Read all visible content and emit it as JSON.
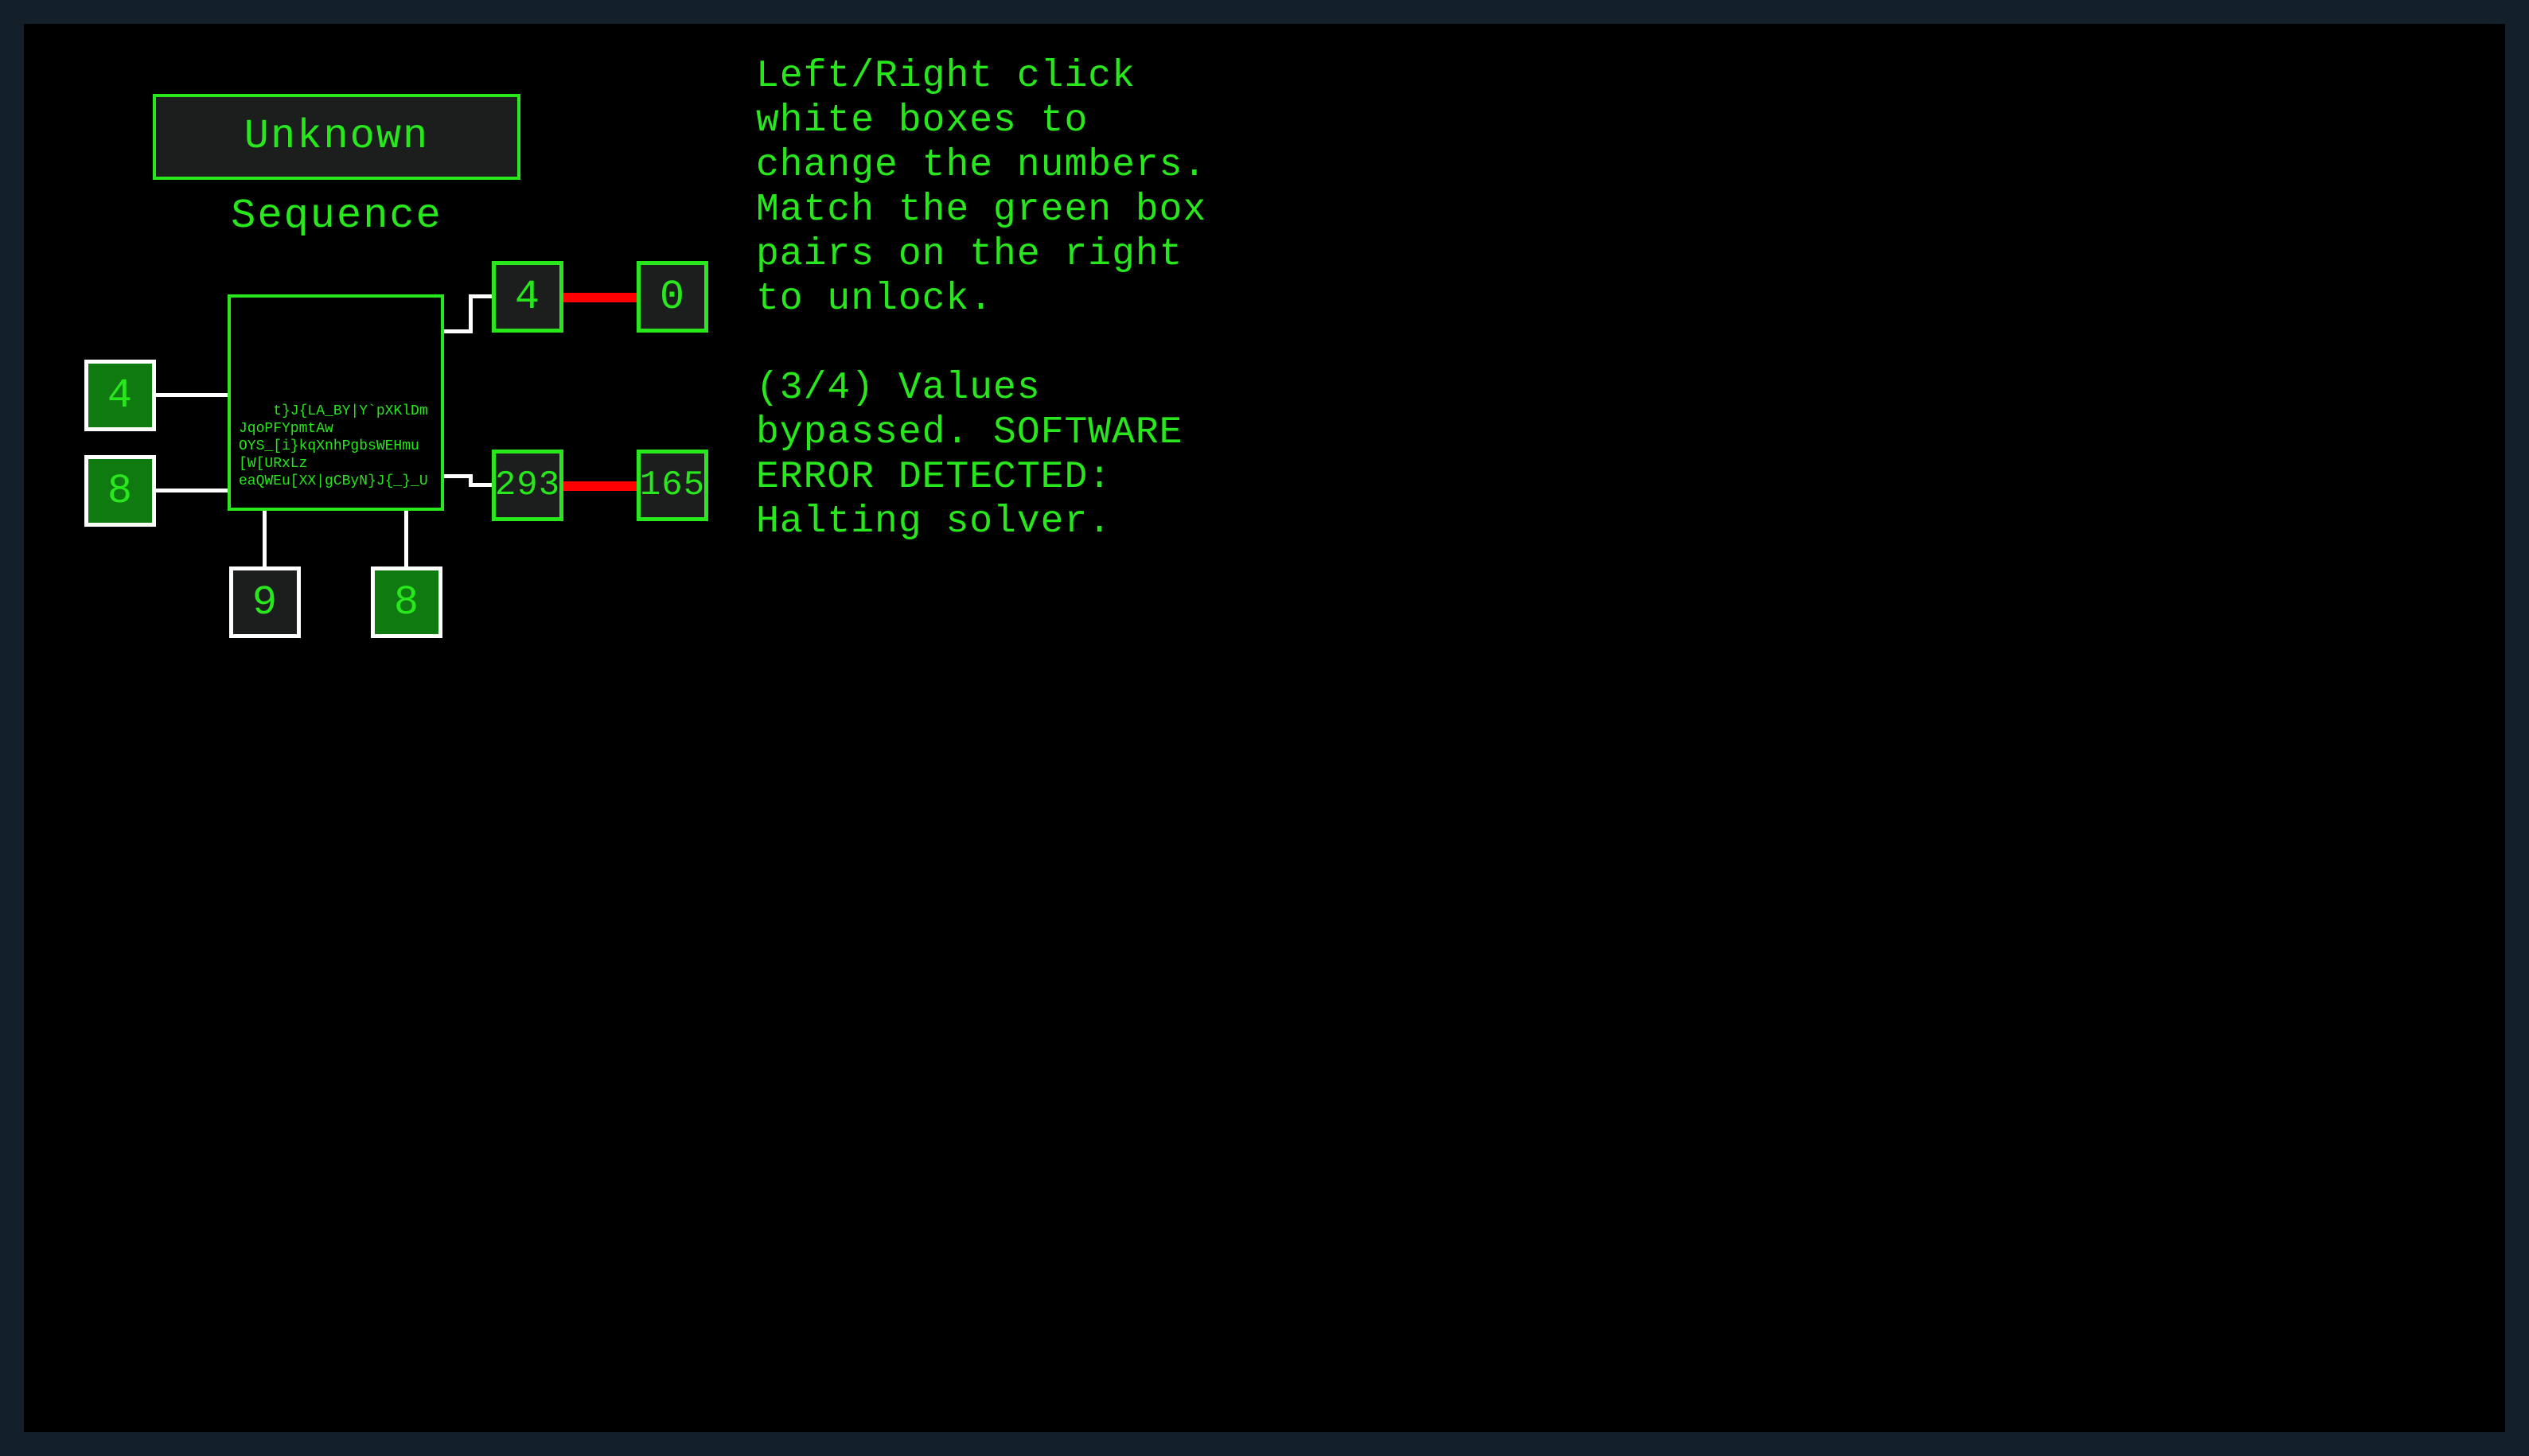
{
  "title": "Unknown Sequence",
  "central_text": "t}J{LA_BY|Y`pXKlDmJqoPFYpmtAw\nOYS_[i}kqXnhPgbsWEHmu[W[URxLz\neaQWEu[XX|gCByN}J{_}_U",
  "inputs": {
    "left_top": "4",
    "left_bottom": "8",
    "bottom_left": "9",
    "bottom_right": "8"
  },
  "outputs": {
    "right_top_out": "4",
    "right_top_target": "0",
    "right_bottom_out": "293",
    "right_bottom_target": "165"
  },
  "instructions_p1": "Left/Right click white boxes to change the numbers. Match the green box pairs on the right to unlock.",
  "instructions_p2": "(3/4) Values bypassed. SOFTWARE ERROR DETECTED: Halting solver.",
  "colors": {
    "green": "#28e71c",
    "dark_fill": "#1c1e1e",
    "red": "#ff0000",
    "white": "#ffffff",
    "green_fill": "#0f7a0f"
  }
}
